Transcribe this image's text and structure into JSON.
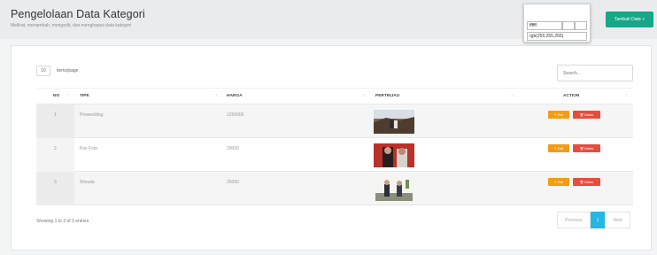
{
  "header": {
    "title": "Pengelolaan Data Kategori",
    "subtitle": "Melihat, menambah, mengedit, dan menghapus data kategori",
    "add_button_label": "Tambah Data +"
  },
  "color_picker": {
    "hex_value": "ffffff",
    "rgb_value": "rgb(255,255,255)"
  },
  "table_controls": {
    "length_value": "10",
    "length_label": "items/page",
    "search_placeholder": "Search..."
  },
  "table": {
    "columns": [
      {
        "label": "NO"
      },
      {
        "label": "TIPE"
      },
      {
        "label": "HARGA"
      },
      {
        "label": "PERTINJAU"
      },
      {
        "label": "ACTION"
      }
    ],
    "rows": [
      {
        "no": "1",
        "tipe": "Prewedding",
        "harga": "1250000",
        "edit_label": "✎ Edit",
        "delete_label": "🗑 Delete"
      },
      {
        "no": "2",
        "tipe": "Pas Foto",
        "harga": "20000",
        "edit_label": "✎ Edit",
        "delete_label": "🗑 Delete"
      },
      {
        "no": "3",
        "tipe": "Wisuda",
        "harga": "25000",
        "edit_label": "✎ Edit",
        "delete_label": "🗑 Delete"
      }
    ]
  },
  "footer": {
    "info": "Showing 1 to 3 of 3 entries",
    "previous_label": "Previous",
    "current_page": "1",
    "next_label": "Next"
  },
  "colors": {
    "accent_green": "#18a689",
    "accent_blue": "#23b7e5",
    "edit_orange": "#f39c12",
    "delete_red": "#e74c3c"
  }
}
